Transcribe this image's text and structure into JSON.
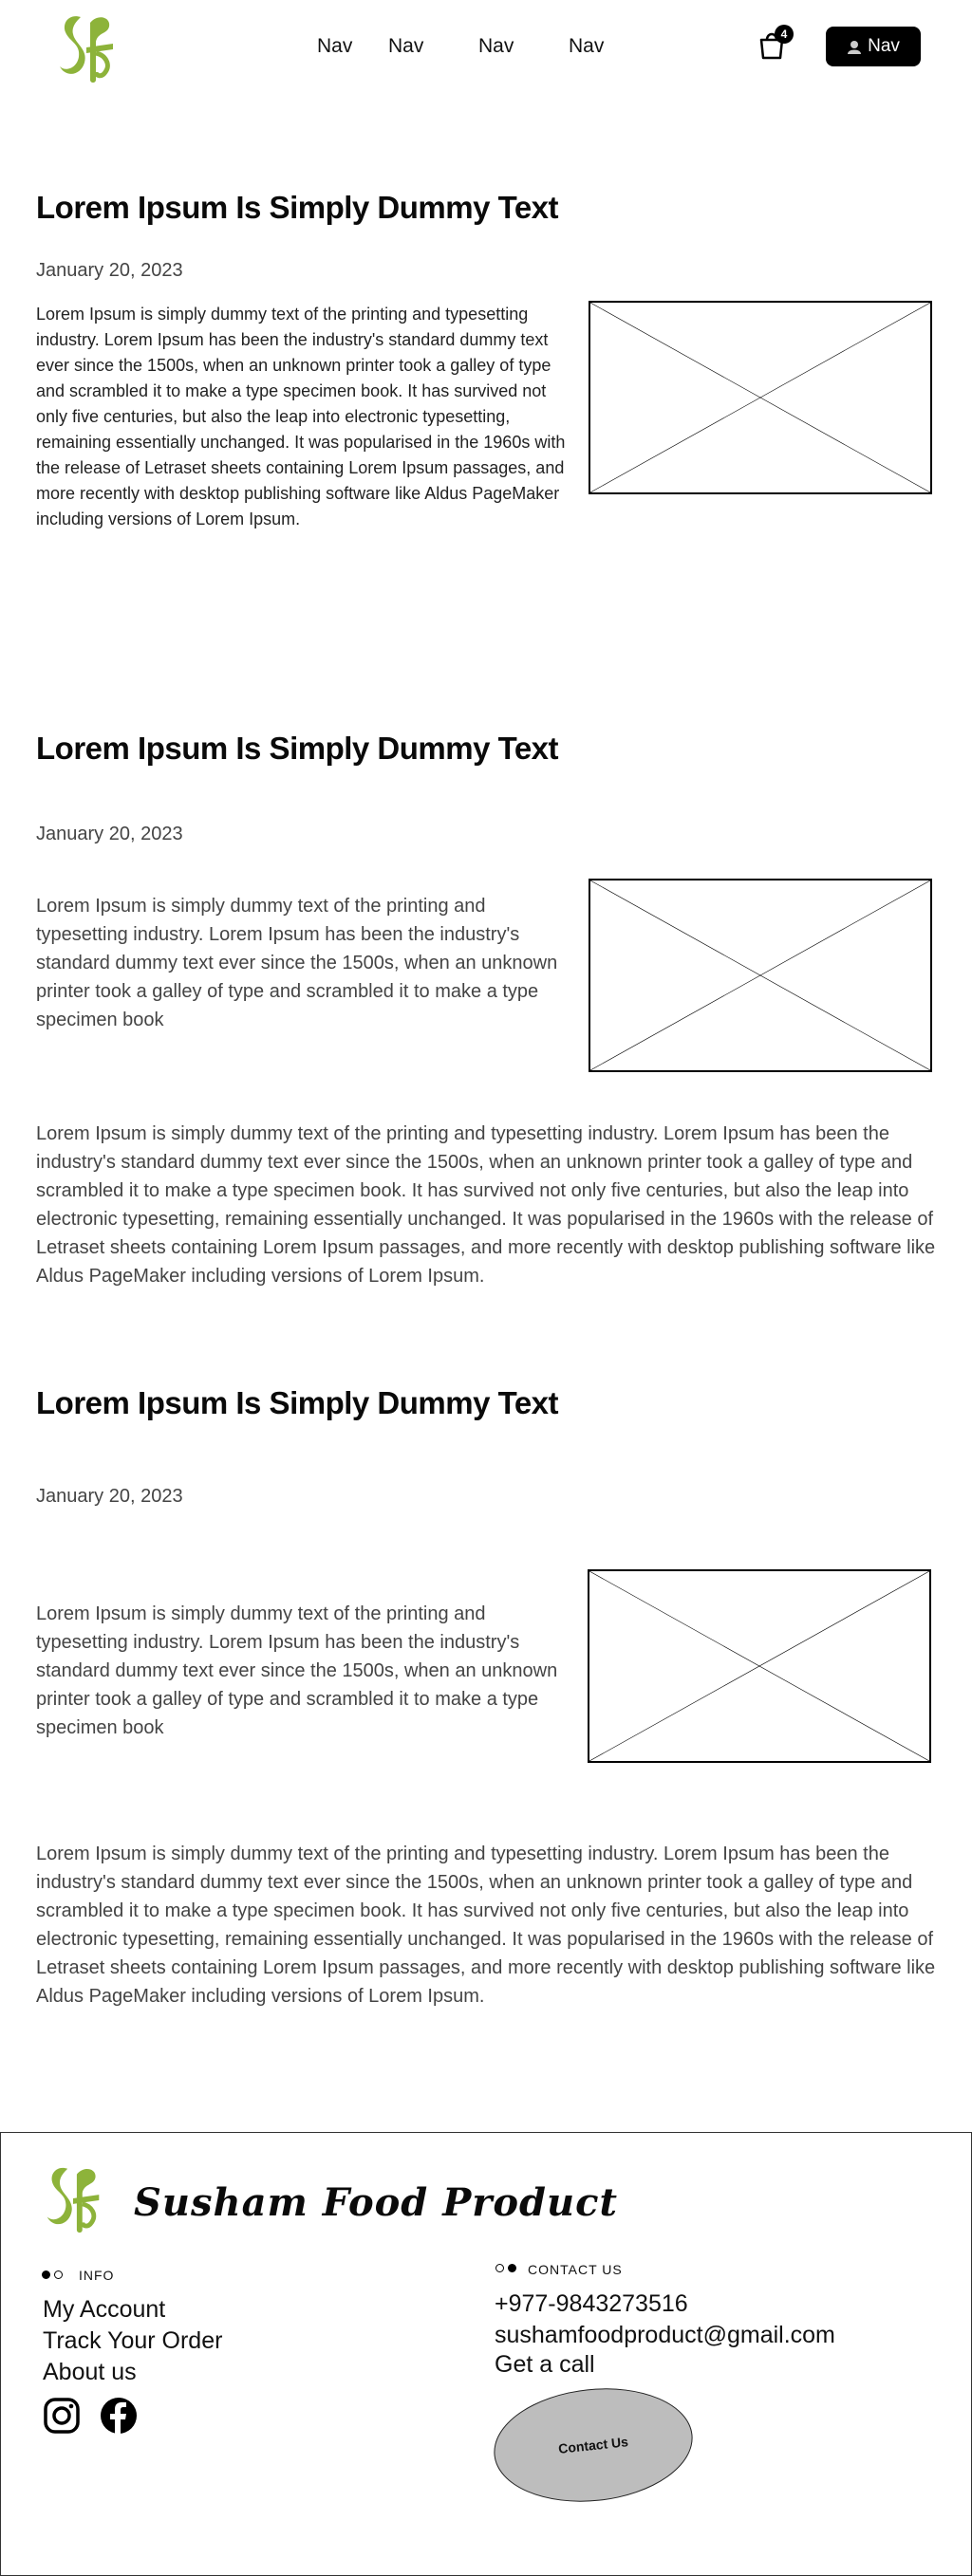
{
  "header": {
    "nav": [
      "Nav",
      "Nav",
      "Nav",
      "Nav"
    ],
    "cart_count": "4",
    "nav_button": "Nav",
    "logo_color": "#8db33a"
  },
  "articles": [
    {
      "title": "Lorem Ipsum Is Simply Dummy Text",
      "date": "January 20, 2023",
      "body": "Lorem Ipsum is simply dummy text of the printing and typesetting industry. Lorem Ipsum has been the industry's standard dummy text ever since the 1500s, when an unknown printer took a galley of type and scrambled it to make a type specimen book. It has survived not only five centuries, but also the leap into electronic typesetting, remaining essentially unchanged. It was popularised in the 1960s with the release of Letraset sheets containing Lorem Ipsum passages, and more recently with desktop publishing software like Aldus PageMaker including versions of Lorem Ipsum."
    },
    {
      "title": "Lorem Ipsum Is Simply Dummy Text",
      "date": "January 20, 2023",
      "intro": "Lorem Ipsum is simply dummy text of the printing and typesetting industry. Lorem Ipsum has been the industry's standard dummy text ever since the 1500s, when an unknown printer took a galley of type and scrambled it to make a type specimen book",
      "body": "Lorem Ipsum is simply dummy text of the printing and typesetting industry. Lorem Ipsum has been the industry's standard dummy text ever since the 1500s, when an unknown printer took a galley of type and scrambled it to make a type specimen book. It has survived not only five centuries, but also the leap into electronic typesetting, remaining essentially unchanged. It was popularised in the 1960s with the release of Letraset sheets containing Lorem Ipsum passages, and more recently with desktop publishing software like Aldus PageMaker including versions of Lorem Ipsum."
    },
    {
      "title": "Lorem Ipsum Is Simply Dummy Text",
      "date": "January 20, 2023",
      "intro": "Lorem Ipsum is simply dummy text of the printing and typesetting industry. Lorem Ipsum has been the industry's standard dummy text ever since the 1500s, when an unknown printer took a galley of type and scrambled it to make a type specimen book",
      "body": "Lorem Ipsum is simply dummy text of the printing and typesetting industry. Lorem Ipsum has been the industry's standard dummy text ever since the 1500s, when an unknown printer took a galley of type and scrambled it to make a type specimen book. It has survived not only five centuries, but also the leap into electronic typesetting, remaining essentially unchanged. It was popularised in the 1960s with the release of Letraset sheets containing Lorem Ipsum passages, and more recently with desktop publishing software like Aldus PageMaker including versions of Lorem Ipsum."
    }
  ],
  "footer": {
    "brand": "Susham Food Product",
    "info_heading": "INFO",
    "info_links": [
      "My Account",
      "Track Your Order",
      "About us"
    ],
    "contact_heading": "CONTACT US",
    "phone": "+977-9843273516",
    "email": "sushamfoodproduct@gmail.com",
    "call": "Get a call",
    "contact_button": "Contact Us",
    "social_icons": [
      "instagram-icon",
      "facebook-icon"
    ]
  }
}
